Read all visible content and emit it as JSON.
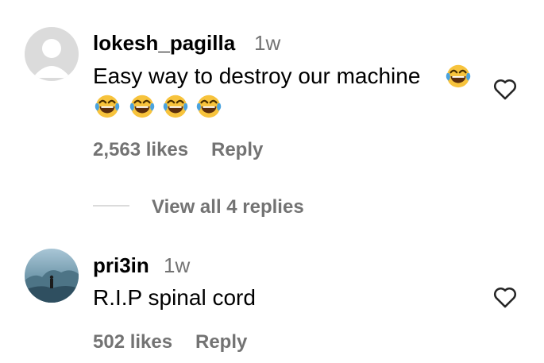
{
  "comments": [
    {
      "username": "lokesh_pagilla",
      "time": "1w",
      "text": "Easy way to destroy our machine",
      "trailing_emoji": "face-with-tears-of-joy",
      "second_line_emojis": [
        "face-with-tears-of-joy",
        "face-with-tears-of-joy",
        "face-with-tears-of-joy",
        "face-with-tears-of-joy"
      ],
      "likes": "2,563 likes",
      "reply": "Reply",
      "like_icon": "heart-outline-icon"
    },
    {
      "username": "pri3in",
      "time": "1w",
      "text": "R.I.P spinal cord",
      "likes": "502 likes",
      "reply": "Reply",
      "like_icon": "heart-outline-icon"
    }
  ],
  "view_replies": "View all 4 replies",
  "colors": {
    "secondary_text": "#737373",
    "avatar_placeholder_bg": "#dbdbdb",
    "emoji_yellow": "#f7c33c"
  }
}
